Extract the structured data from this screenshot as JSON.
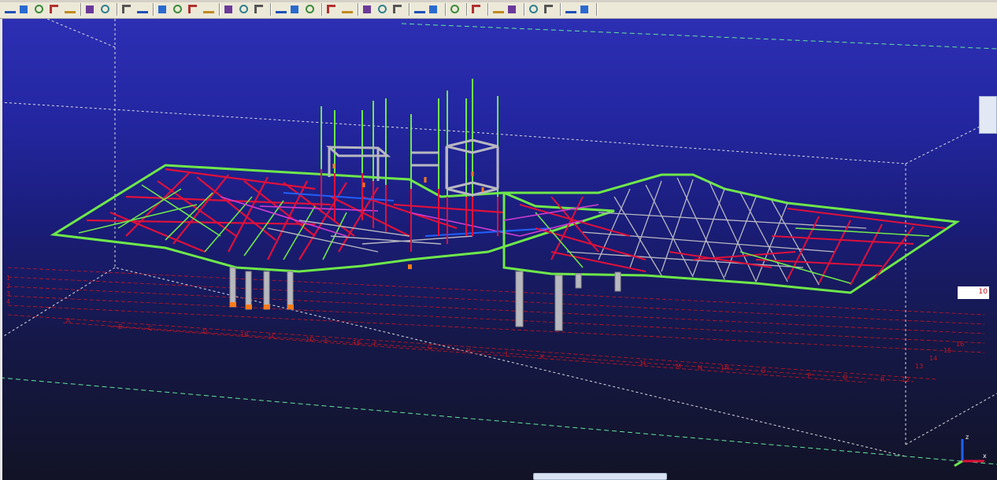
{
  "toolbar": {
    "buttons": [
      "beam-icon",
      "column-icon",
      "brace-icon",
      "plate-icon",
      "bolt-icon",
      "weld-icon",
      "part-icon",
      "assembly-icon",
      "line-icon",
      "polyline-icon",
      "polygon-icon",
      "rectangle-icon",
      "cut-icon",
      "fitting-icon",
      "component-icon",
      "zoom-in-icon",
      "zoom-out-icon",
      "zoom-window-icon",
      "zoom-previous-icon",
      "zoom-next-icon",
      "view-icon",
      "view-plane-icon",
      "view-3d-icon",
      "clip-plane-icon",
      "fly-icon",
      "render-icon",
      "inquire-icon",
      "inquire-object-icon",
      "numbering-icon",
      "numbering-series-icon",
      "report-icon",
      "drawing-icon",
      "help-icon",
      "help-context-icon"
    ]
  },
  "viewport": {
    "grid_labels_left": [
      "1B",
      "1C",
      "1D",
      "1E",
      "1F",
      "1G"
    ],
    "grid_labels_bottom": [
      "A",
      "B",
      "C",
      "D",
      "E",
      "F",
      "G",
      "H",
      "I",
      "J",
      "K",
      "L",
      "M",
      "N",
      "O",
      "P",
      "Q",
      "R"
    ],
    "grid_labels_right": [
      "12",
      "13",
      "14",
      "15",
      "16"
    ],
    "right_label": "10"
  },
  "colors": {
    "bg_top": "#2d2fb4",
    "bg_bottom": "#121326",
    "member_red": "#e0103a",
    "member_green": "#6ee84a",
    "member_gray": "#b8b8c0",
    "member_magenta": "#d43cd4",
    "member_orange": "#ff7a18",
    "member_blue": "#2060ff",
    "grid_red": "#c8141e",
    "bbox_line": "#d8d8d8"
  }
}
